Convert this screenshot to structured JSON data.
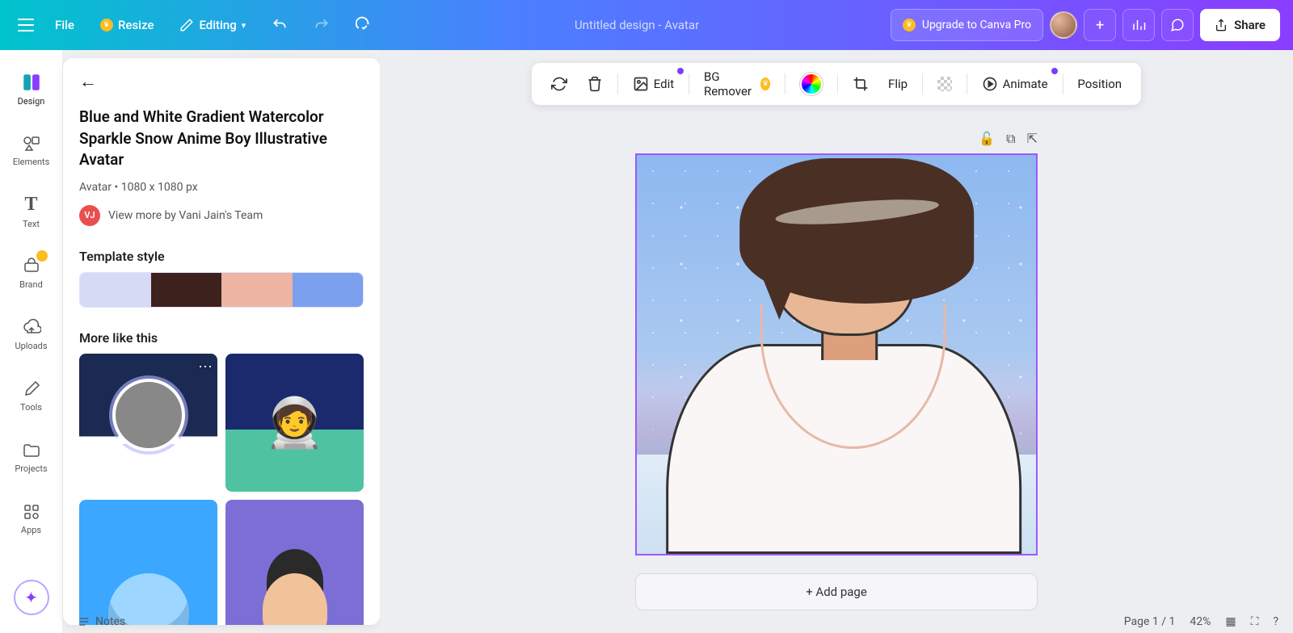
{
  "header": {
    "file": "File",
    "resize": "Resize",
    "editing": "Editing",
    "title_placeholder": "Untitled design - Avatar",
    "upgrade": "Upgrade to Canva Pro",
    "share": "Share"
  },
  "rail": {
    "design": "Design",
    "elements": "Elements",
    "text": "Text",
    "brand": "Brand",
    "uploads": "Uploads",
    "tools": "Tools",
    "projects": "Projects",
    "apps": "Apps"
  },
  "panel": {
    "title": "Blue and White Gradient Watercolor Sparkle Snow Anime Boy Illustrative Avatar",
    "type": "Avatar",
    "dimensions": "1080 x 1080 px",
    "author_initials": "VJ",
    "author_link": "View more by Vani Jain's Team",
    "style_heading": "Template style",
    "palette": [
      "#d6daf5",
      "#3d211d",
      "#edb4a3",
      "#7aa0ee"
    ],
    "more_heading": "More like this"
  },
  "toolbar": {
    "edit": "Edit",
    "bg_remover": "BG Remover",
    "flip": "Flip",
    "animate": "Animate",
    "position": "Position"
  },
  "canvas": {
    "add_page": "+ Add page"
  },
  "footer": {
    "notes": "Notes",
    "page_indicator": "Page 1 / 1",
    "zoom": "42%"
  }
}
